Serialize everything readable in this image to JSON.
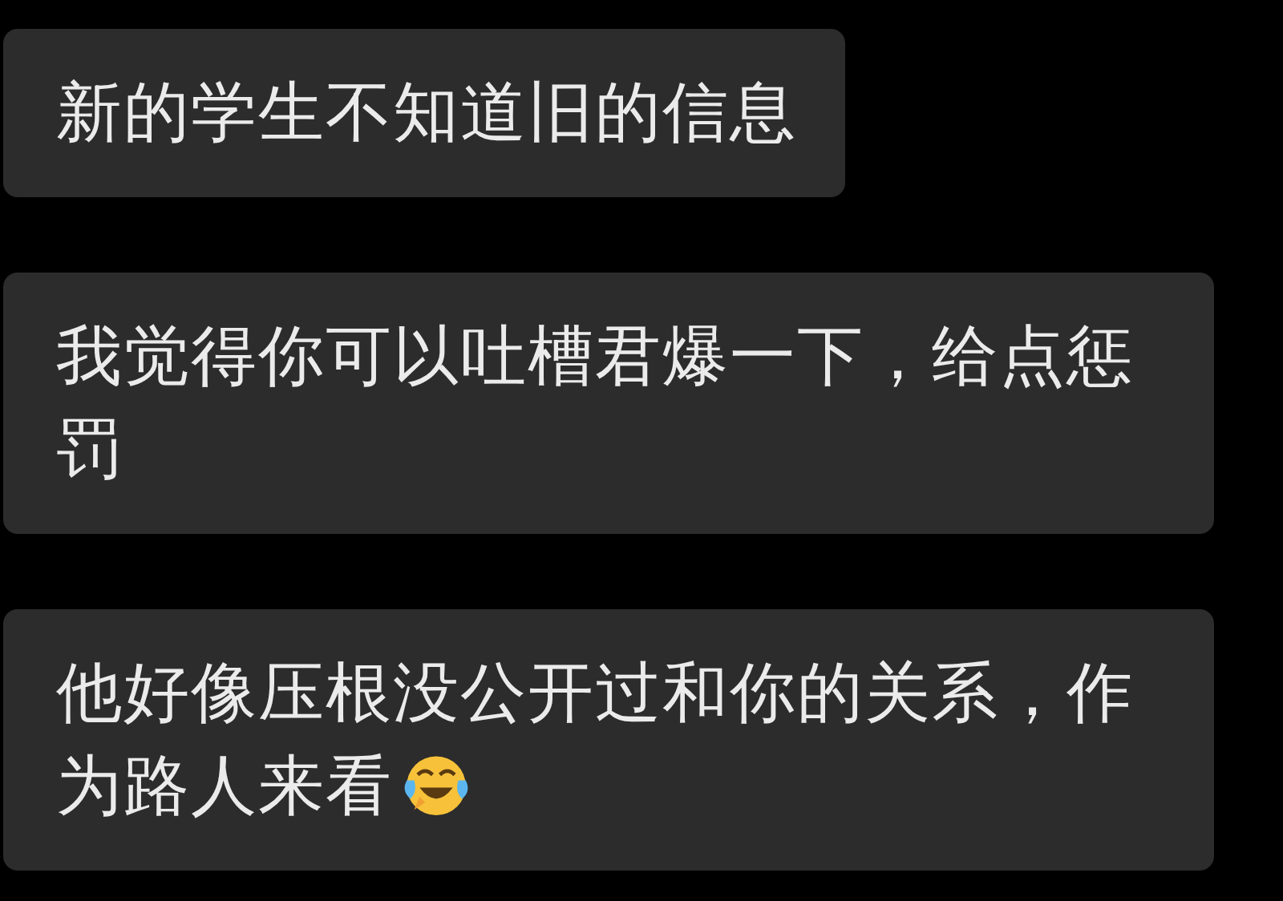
{
  "messages": [
    {
      "text": "新的学生不知道旧的信息",
      "emoji": false
    },
    {
      "text": "我觉得你可以吐槽君爆一下，给点惩罚",
      "emoji": false
    },
    {
      "text": "他好像压根没公开过和你的关系，作为路人来看",
      "emoji": true
    }
  ]
}
